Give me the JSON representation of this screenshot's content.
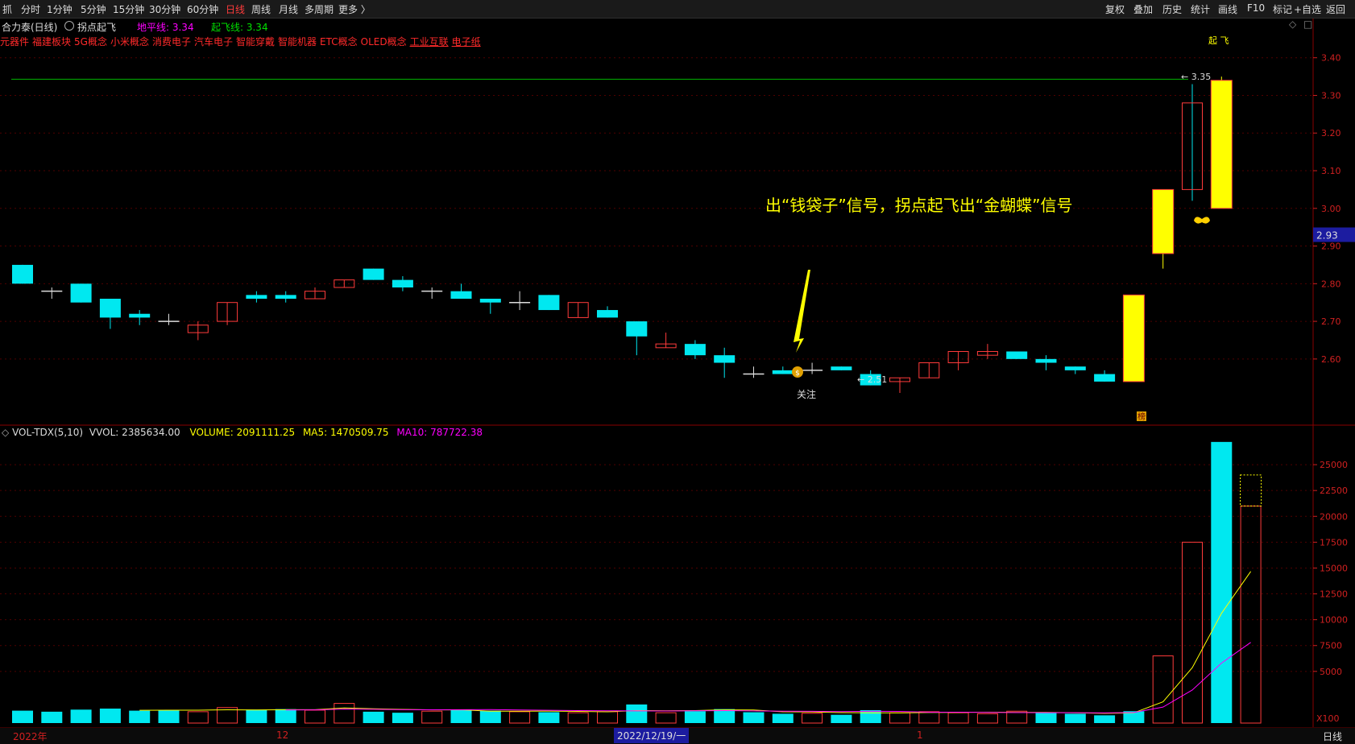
{
  "toolbar": {
    "left_icon": "抓",
    "periods": [
      "分时",
      "1分钟",
      "5分钟",
      "15分钟",
      "30分钟",
      "60分钟",
      "日线",
      "周线",
      "月线",
      "多周期",
      "更多 〉"
    ],
    "active_period": "日线",
    "right_buttons": [
      "复权",
      "叠加",
      "历史",
      "统计",
      "画线",
      "F10",
      "标记",
      "+自选",
      "返回"
    ]
  },
  "info": {
    "stock": "合力泰(日线)",
    "formula": "拐点起飞",
    "ground_label": "地平线: 3.34",
    "takeoff_label": "起飞线: 3.34",
    "takeoff_tag": "起 飞"
  },
  "concepts": [
    "元器件",
    "福建板块",
    "5G概念",
    "小米概念",
    "消费电子",
    "汽车电子",
    "智能穿戴",
    "智能机器",
    "ETC概念",
    "OLED概念",
    "工业互联",
    "电子纸"
  ],
  "annotation": "出“钱袋子”信号，拐点起飞出“金蝴蝶”信号",
  "focus_label": "关注",
  "low_label": "← 2.51",
  "high_label": "← 3.35",
  "bang_label": "榜",
  "current_price": "2.93",
  "price_axis": [
    "3.40",
    "3.30",
    "3.20",
    "3.10",
    "3.00",
    "2.90",
    "2.80",
    "2.70",
    "2.60"
  ],
  "volume_header": {
    "name": "VOL-TDX(5,10)",
    "vvol": "VVOL: 2385634.00",
    "volume": "VOLUME: 2091111.25",
    "ma5": "MA5: 1470509.75",
    "ma10": "MA10: 787722.38"
  },
  "volume_axis": [
    "25000",
    "22500",
    "20000",
    "17500",
    "15000",
    "12500",
    "10000",
    "7500",
    "5000"
  ],
  "volume_unit": "X100",
  "dates": {
    "d1": "2022年",
    "d2": "12",
    "d3": "2022/12/19/一",
    "d4": "1"
  },
  "corner_label": "日线",
  "colors": {
    "up": "#ff3b3b",
    "down": "#00e8f0",
    "signal": "#ffff00",
    "ground": "#00b400",
    "ma10": "#ff00ff"
  },
  "chart_data": {
    "type": "candlestick",
    "candles": [
      {
        "o": 2.85,
        "c": 2.8,
        "h": 2.85,
        "l": 2.8
      },
      {
        "o": 2.78,
        "c": 2.78,
        "h": 2.79,
        "l": 2.76
      },
      {
        "o": 2.8,
        "c": 2.75,
        "h": 2.8,
        "l": 2.75
      },
      {
        "o": 2.76,
        "c": 2.71,
        "h": 2.76,
        "l": 2.68
      },
      {
        "o": 2.72,
        "c": 2.71,
        "h": 2.73,
        "l": 2.69
      },
      {
        "o": 2.7,
        "c": 2.7,
        "h": 2.72,
        "l": 2.69
      },
      {
        "o": 2.67,
        "c": 2.69,
        "h": 2.7,
        "l": 2.65
      },
      {
        "o": 2.7,
        "c": 2.75,
        "h": 2.75,
        "l": 2.69
      },
      {
        "o": 2.77,
        "c": 2.76,
        "h": 2.78,
        "l": 2.75
      },
      {
        "o": 2.77,
        "c": 2.76,
        "h": 2.78,
        "l": 2.75
      },
      {
        "o": 2.76,
        "c": 2.78,
        "h": 2.79,
        "l": 2.76
      },
      {
        "o": 2.79,
        "c": 2.81,
        "h": 2.81,
        "l": 2.79
      },
      {
        "o": 2.84,
        "c": 2.81,
        "h": 2.84,
        "l": 2.81
      },
      {
        "o": 2.81,
        "c": 2.79,
        "h": 2.82,
        "l": 2.78
      },
      {
        "o": 2.78,
        "c": 2.78,
        "h": 2.79,
        "l": 2.76
      },
      {
        "o": 2.78,
        "c": 2.76,
        "h": 2.8,
        "l": 2.76
      },
      {
        "o": 2.76,
        "c": 2.75,
        "h": 2.76,
        "l": 2.72
      },
      {
        "o": 2.75,
        "c": 2.75,
        "h": 2.78,
        "l": 2.73
      },
      {
        "o": 2.77,
        "c": 2.73,
        "h": 2.77,
        "l": 2.73
      },
      {
        "o": 2.71,
        "c": 2.75,
        "h": 2.75,
        "l": 2.71
      },
      {
        "o": 2.73,
        "c": 2.71,
        "h": 2.74,
        "l": 2.71
      },
      {
        "o": 2.7,
        "c": 2.66,
        "h": 2.7,
        "l": 2.61
      },
      {
        "o": 2.63,
        "c": 2.64,
        "h": 2.67,
        "l": 2.63
      },
      {
        "o": 2.64,
        "c": 2.61,
        "h": 2.65,
        "l": 2.6
      },
      {
        "o": 2.61,
        "c": 2.59,
        "h": 2.63,
        "l": 2.55
      },
      {
        "o": 2.56,
        "c": 2.56,
        "h": 2.58,
        "l": 2.55
      },
      {
        "o": 2.57,
        "c": 2.56,
        "h": 2.58,
        "l": 2.56
      },
      {
        "o": 2.57,
        "c": 2.57,
        "h": 2.59,
        "l": 2.56
      },
      {
        "o": 2.58,
        "c": 2.57,
        "h": 2.58,
        "l": 2.57
      },
      {
        "o": 2.56,
        "c": 2.53,
        "h": 2.57,
        "l": 2.53
      },
      {
        "o": 2.54,
        "c": 2.55,
        "h": 2.55,
        "l": 2.51
      },
      {
        "o": 2.55,
        "c": 2.59,
        "h": 2.59,
        "l": 2.55
      },
      {
        "o": 2.59,
        "c": 2.62,
        "h": 2.62,
        "l": 2.57
      },
      {
        "o": 2.61,
        "c": 2.62,
        "h": 2.64,
        "l": 2.6
      },
      {
        "o": 2.62,
        "c": 2.6,
        "h": 2.62,
        "l": 2.6
      },
      {
        "o": 2.6,
        "c": 2.59,
        "h": 2.61,
        "l": 2.57
      },
      {
        "o": 2.58,
        "c": 2.57,
        "h": 2.58,
        "l": 2.56
      },
      {
        "o": 2.56,
        "c": 2.54,
        "h": 2.57,
        "l": 2.54
      },
      {
        "o": 2.54,
        "c": 2.77,
        "h": 2.77,
        "l": 2.54
      },
      {
        "o": 2.88,
        "c": 3.05,
        "h": 3.05,
        "l": 2.84
      },
      {
        "o": 3.05,
        "c": 3.28,
        "h": 3.33,
        "l": 3.02
      },
      {
        "o": 3.0,
        "c": 3.34,
        "h": 3.35,
        "l": 3.0
      }
    ],
    "volumes": [
      1200,
      1100,
      1300,
      1400,
      1200,
      1250,
      1100,
      1500,
      1300,
      1350,
      1250,
      1900,
      1100,
      1000,
      1150,
      1300,
      1200,
      1100,
      1050,
      1000,
      1100,
      1800,
      1000,
      1150,
      1350,
      1050,
      900,
      950,
      800,
      1250,
      1000,
      1100,
      1000,
      900,
      1150,
      1000,
      900,
      750,
      1150,
      6500,
      17500,
      27200,
      21000
    ],
    "volume_types": [
      "down",
      "down",
      "down",
      "down",
      "down",
      "down",
      "up",
      "up",
      "down",
      "down",
      "up",
      "up",
      "down",
      "down",
      "up",
      "down",
      "down",
      "up",
      "down",
      "up",
      "up",
      "down",
      "up",
      "down",
      "down",
      "down",
      "down",
      "up",
      "down",
      "down",
      "up",
      "up",
      "up",
      "up",
      "up",
      "down",
      "down",
      "down",
      "down",
      "up",
      "up",
      "down",
      "up"
    ],
    "vol_ymax": 27500
  }
}
